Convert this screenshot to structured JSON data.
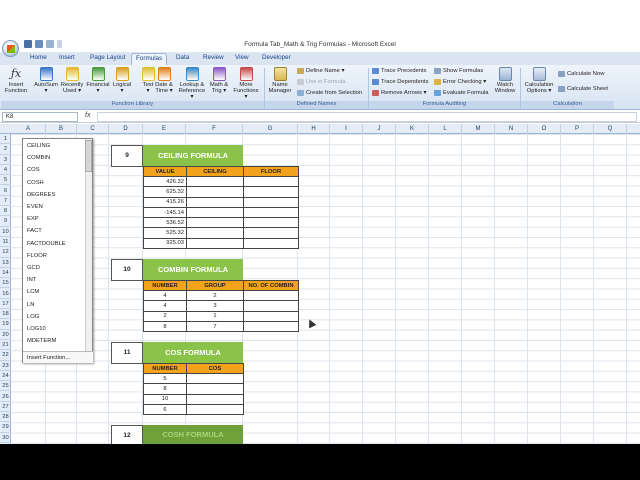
{
  "window": {
    "title": "Formula Tab_Math & Trig Formulas - Microsoft Excel",
    "controls": [
      "–",
      "▭",
      "✕"
    ]
  },
  "tabs": [
    {
      "label": "Home"
    },
    {
      "label": "Insert"
    },
    {
      "label": "Page Layout"
    },
    {
      "label": "Formulas",
      "active": true
    },
    {
      "label": "Data"
    },
    {
      "label": "Review"
    },
    {
      "label": "View"
    },
    {
      "label": "Developer"
    }
  ],
  "ribbon": {
    "insert_function": [
      "Insert",
      "Function"
    ],
    "library": [
      {
        "label1": "AutoSum",
        "label2": "▾",
        "icon": "sigma-icon",
        "color": "#3c78c8"
      },
      {
        "label1": "Recently",
        "label2": "Used ▾",
        "icon": "star-book-icon",
        "color": "#e8b830"
      },
      {
        "label1": "Financial",
        "label2": "▾",
        "icon": "book-icon",
        "color": "#4a9a3a"
      },
      {
        "label1": "Logical",
        "label2": "▾",
        "icon": "book-icon",
        "color": "#d8a020"
      },
      {
        "label1": "Text",
        "label2": "▾",
        "icon": "book-icon",
        "color": "#e0c030"
      },
      {
        "label1": "Date &",
        "label2": "Time ▾",
        "icon": "book-icon",
        "color": "#e08020"
      },
      {
        "label1": "Lookup &",
        "label2": "Reference ▾",
        "icon": "book-icon",
        "color": "#3a8ac8"
      },
      {
        "label1": "Math &",
        "label2": "Trig ▾",
        "icon": "book-icon",
        "color": "#8a5ac8"
      },
      {
        "label1": "More",
        "label2": "Functions ▾",
        "icon": "book-icon",
        "color": "#c84a4a"
      }
    ],
    "library_label": "Function Library",
    "name_manager": [
      "Name",
      "Manager"
    ],
    "defined_names": [
      "Define Name ▾",
      "Use in Formula",
      "Create from Selection"
    ],
    "defined_names_label": "Defined Names",
    "auditing_left": [
      "Trace Precedents",
      "Trace Dependents",
      "Remove Arrows ▾"
    ],
    "auditing_right": [
      "Show Formulas",
      "Error Checking ▾",
      "Evaluate Formula"
    ],
    "watch_window": [
      "Watch",
      "Window"
    ],
    "auditing_label": "Formula Auditing",
    "calc_options": [
      "Calculation",
      "Options ▾"
    ],
    "calc_now": "Calculate Now",
    "calc_sheet": "Calculate Sheet",
    "calculation_label": "Calculation"
  },
  "formula_bar": {
    "name_box": "K8",
    "fx": "fx"
  },
  "columns": [
    "A",
    "B",
    "C",
    "D",
    "E",
    "F",
    "G",
    "H",
    "I",
    "J",
    "K",
    "L",
    "M",
    "N",
    "O",
    "P",
    "Q"
  ],
  "rows": [
    "1",
    "2",
    "3",
    "4",
    "5",
    "6",
    "7",
    "8",
    "9",
    "10",
    "11",
    "12",
    "13",
    "14",
    "15",
    "16",
    "17",
    "18",
    "19",
    "20",
    "21",
    "22",
    "23",
    "24",
    "25",
    "26",
    "27",
    "28",
    "29",
    "30"
  ],
  "autocomplete": {
    "items": [
      "CEILING",
      "COMBIN",
      "COS",
      "COSH",
      "DEGREES",
      "EVEN",
      "EXP",
      "FACT",
      "FACTDOUBLE",
      "FLOOR",
      "GCD",
      "INT",
      "LCM",
      "LN",
      "LOG",
      "LOG10",
      "MDETERM"
    ],
    "footer": "Insert Function..."
  },
  "sections": [
    {
      "number": "9",
      "title": "CEILING FORMULA",
      "headers": [
        "VALUE",
        "CEILING",
        "FLOOR"
      ],
      "rows": [
        [
          "426.32",
          "",
          ""
        ],
        [
          "625.32",
          "",
          ""
        ],
        [
          "415.26",
          "",
          ""
        ],
        [
          "-145.14",
          "",
          ""
        ],
        [
          "536.52",
          "",
          ""
        ],
        [
          "525.32",
          "",
          ""
        ],
        [
          "925.03",
          "",
          ""
        ]
      ]
    },
    {
      "number": "10",
      "title": "COMBIN FORMULA",
      "headers": [
        "NUMBER",
        "GROUP",
        "NO. OF COMBIN"
      ],
      "rows": [
        [
          "4",
          "2",
          ""
        ],
        [
          "4",
          "3",
          ""
        ],
        [
          "2",
          "1",
          ""
        ],
        [
          "8",
          "7",
          ""
        ]
      ]
    },
    {
      "number": "11",
      "title": "COS FORMULA",
      "headers": [
        "NUMBER",
        "COS"
      ],
      "rows": [
        [
          "5",
          ""
        ],
        [
          "8",
          ""
        ],
        [
          "10",
          ""
        ],
        [
          "6",
          ""
        ]
      ]
    },
    {
      "number": "12",
      "title": "COSH FORMULA"
    }
  ]
}
